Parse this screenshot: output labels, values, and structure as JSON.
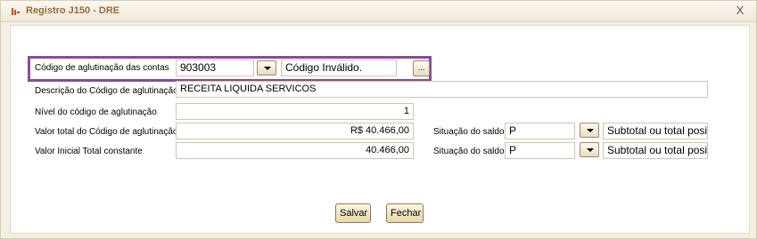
{
  "window": {
    "title": "Registro J150 - DRE",
    "close_glyph": "X"
  },
  "form": {
    "codigo": {
      "label": "Código de aglutinação das contas",
      "value": "903003",
      "status": "Código Inválido.",
      "lookup_glyph": "..."
    },
    "descricao": {
      "label": "Descrição do Código de aglutinação",
      "value": "RECEITA LIQUIDA SERVICOS"
    },
    "nivel": {
      "label": "Nível do código de aglutinação",
      "value": "1"
    },
    "valor_total": {
      "label": "Valor total do Código de aglutinação",
      "value": "R$ 40.466,00",
      "situacao_label": "Situação do saldo",
      "situacao_value": "P",
      "situacao_desc": "Subtotal ou total positivo"
    },
    "valor_inicial": {
      "label": "Valor Inicial Total constante",
      "value": "40.466,00",
      "situacao_label": "Situação do saldo",
      "situacao_value": "P",
      "situacao_desc": "Subtotal ou total positivo"
    }
  },
  "buttons": {
    "save": "Salvar",
    "close": "Fechar"
  },
  "colors": {
    "accent": "#8a4a9a",
    "title": "#9a6b3a"
  }
}
